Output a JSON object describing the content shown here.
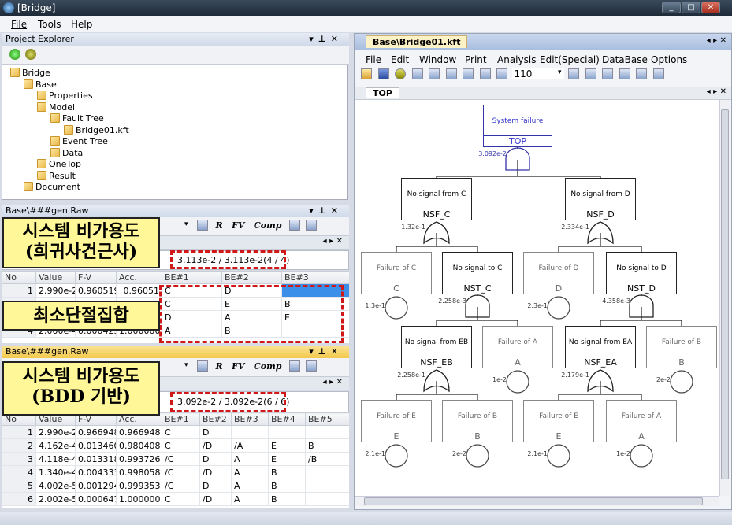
{
  "window": {
    "title": "[Bridge]",
    "controls": [
      "_",
      "□",
      "✕"
    ]
  },
  "menu": [
    "File",
    "Tools",
    "Help"
  ],
  "project_explorer": {
    "title": "Project Explorer",
    "tree": [
      {
        "label": "Bridge",
        "icon": "project-icon",
        "level": 0
      },
      {
        "label": "Base",
        "icon": "folder-icon",
        "level": 1
      },
      {
        "label": "Properties",
        "icon": "properties-icon",
        "level": 2
      },
      {
        "label": "Model",
        "icon": "folder-icon",
        "level": 2
      },
      {
        "label": "Fault Tree",
        "icon": "folder-icon",
        "level": 3
      },
      {
        "label": "Bridge01.kft",
        "icon": "fault-tree-file-icon",
        "level": 4
      },
      {
        "label": "Event Tree",
        "icon": "folder-icon",
        "level": 3
      },
      {
        "label": "Data",
        "icon": "folder-icon",
        "level": 3
      },
      {
        "label": "OneTop",
        "icon": "onetop-icon",
        "level": 2
      },
      {
        "label": "Result",
        "icon": "result-icon",
        "level": 2
      },
      {
        "label": "Document",
        "icon": "folder-icon",
        "level": 1
      }
    ]
  },
  "panel_mcs": {
    "title": "Base\\###gen.Raw",
    "tools": [
      "R",
      "FV",
      "Comp"
    ],
    "result": "3.113e-2 / 3.113e-2(4 / 4)",
    "columns": [
      "No",
      "Value",
      "F-V",
      "Acc.",
      "BE#1",
      "BE#2",
      "BE#3"
    ],
    "rows": [
      [
        "1",
        "2.990e-2",
        "0.960519",
        "0.96051",
        "C",
        "D",
        ""
      ],
      [
        "",
        "",
        "",
        "",
        "C",
        "E",
        "B"
      ],
      [
        "",
        "",
        "",
        "",
        "D",
        "A",
        "E"
      ],
      [
        "4",
        "2.000e-4",
        "0.000425",
        "1.000000",
        "A",
        "B",
        ""
      ]
    ],
    "overlay_top": [
      "시스템 비가용도",
      "(희귀사건근사)"
    ],
    "overlay_bottom": "최소단절집합"
  },
  "panel_bdd": {
    "title": "Base\\###gen.Raw",
    "tools": [
      "R",
      "FV",
      "Comp"
    ],
    "result": "3.092e-2 / 3.092e-2(6 / 6)",
    "columns": [
      "No",
      "Value",
      "F-V",
      "Acc.",
      "BE#1",
      "BE#2",
      "BE#3",
      "BE#4",
      "BE#5"
    ],
    "rows": [
      [
        "1",
        "2.990e-2",
        "0.966948",
        "0.966948",
        "C",
        "D",
        "",
        "",
        ""
      ],
      [
        "2",
        "4.162e-4",
        "0.013460",
        "0.980408",
        "C",
        "/D",
        "/A",
        "E",
        "B"
      ],
      [
        "3",
        "4.118e-4",
        "0.013318",
        "0.993726",
        "/C",
        "D",
        "A",
        "E",
        "/B"
      ],
      [
        "4",
        "1.340e-4",
        "0.004333",
        "0.998058",
        "/C",
        "/D",
        "A",
        "B",
        ""
      ],
      [
        "5",
        "4.002e-5",
        "0.001294",
        "0.999353",
        "/C",
        "D",
        "A",
        "B",
        ""
      ],
      [
        "6",
        "2.002e-5",
        "0.000647",
        "1.000000",
        "C",
        "/D",
        "A",
        "B",
        ""
      ]
    ],
    "overlay": [
      "시스템 비가용도",
      "(BDD 기반)"
    ]
  },
  "editor": {
    "tab": "Base\\Bridge01.kft",
    "menu": [
      "File",
      "Edit",
      "Window",
      "Print",
      "Analysis",
      "Edit(Special)",
      "DataBase",
      "Options"
    ],
    "zoom": "110",
    "page_tab": "TOP"
  },
  "fault_tree": {
    "nodes": [
      {
        "id": "TOP",
        "description": "System failure",
        "gate": "and",
        "probability": "3.092e-2"
      },
      {
        "id": "NSF_C",
        "description": "No signal from C",
        "gate": "or",
        "probability": "1.32e-1"
      },
      {
        "id": "NSF_D",
        "description": "No signal from D",
        "gate": "or",
        "probability": "2.334e-1"
      },
      {
        "id": "C",
        "description": "Failure of C",
        "gate": "basic",
        "probability": "1.3e-1"
      },
      {
        "id": "NST_C",
        "description": "No signal to C",
        "gate": "and",
        "probability": "2.258e-3"
      },
      {
        "id": "D",
        "description": "Failure of D",
        "gate": "basic",
        "probability": "2.3e-1"
      },
      {
        "id": "NST_D",
        "description": "No signal to D",
        "gate": "and",
        "probability": "4.358e-3"
      },
      {
        "id": "NSF_EB",
        "description": "No signal from EB",
        "gate": "or",
        "probability": "2.258e-1"
      },
      {
        "id": "A",
        "description": "Failure of A",
        "gate": "basic",
        "probability": "1e-2"
      },
      {
        "id": "NSF_EA",
        "description": "No signal from EA",
        "gate": "or",
        "probability": "2.179e-1"
      },
      {
        "id": "B",
        "description": "Failure of B",
        "gate": "basic",
        "probability": "2e-2"
      },
      {
        "id": "E",
        "description": "Failure of E",
        "gate": "basic",
        "probability": "2.1e-1"
      },
      {
        "id": "B",
        "description": "Failure of B",
        "gate": "basic",
        "probability": "2e-2"
      },
      {
        "id": "E",
        "description": "Failure of E",
        "gate": "basic",
        "probability": "2.1e-1"
      },
      {
        "id": "A",
        "description": "Failure of A",
        "gate": "basic",
        "probability": "1e-2"
      }
    ]
  }
}
